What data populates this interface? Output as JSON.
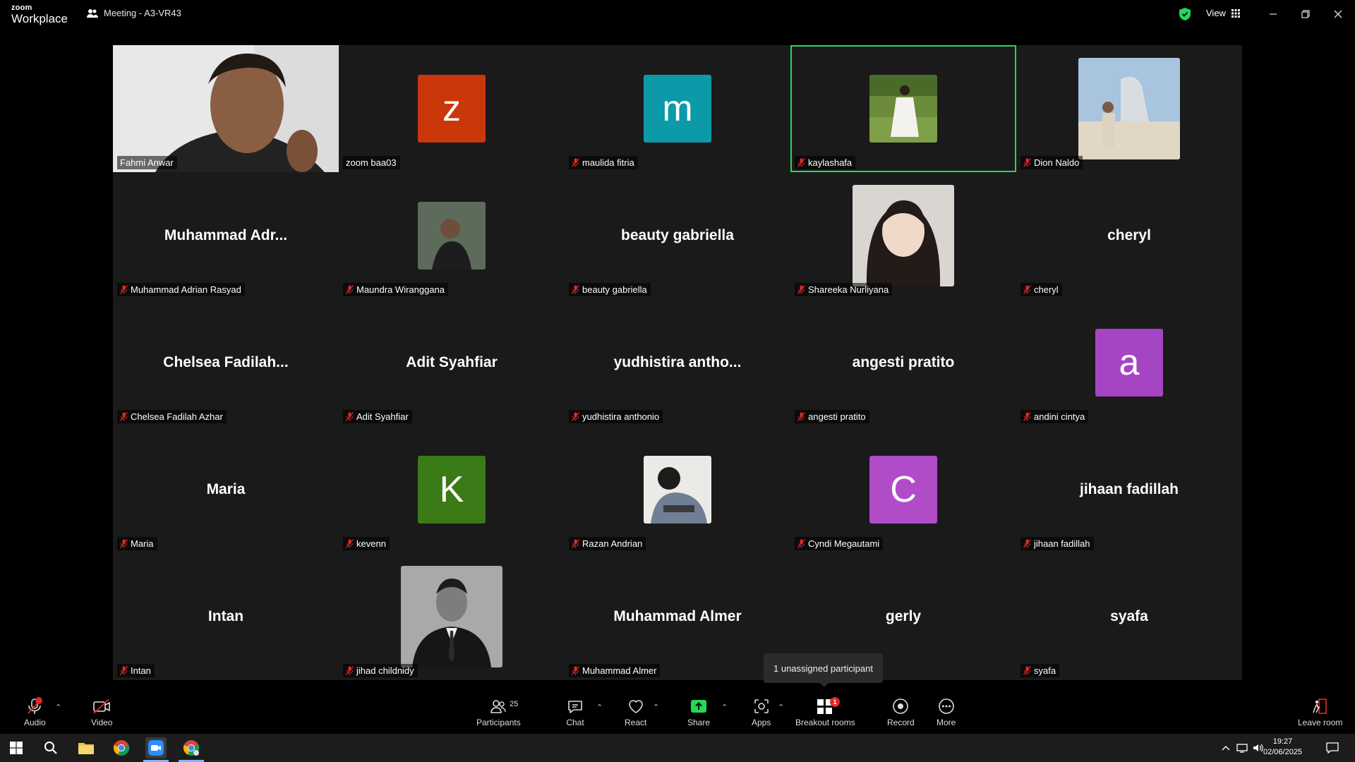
{
  "app": {
    "brand_top": "zoom",
    "brand_bottom": "Workplace",
    "meeting_title": "Meeting - A3-VR43",
    "view_label": "View"
  },
  "participants": [
    {
      "name": "Fahmi Anwar",
      "display": "",
      "type": "video",
      "muted": false
    },
    {
      "name": "zoom baa03",
      "display": "z",
      "type": "avatar",
      "color": "#c9370a",
      "muted": false
    },
    {
      "name": "maulida fitria",
      "display": "m",
      "type": "avatar",
      "color": "#0c9aa8",
      "muted": true
    },
    {
      "name": "kaylashafa",
      "display": "",
      "type": "photo",
      "muted": true,
      "active": true
    },
    {
      "name": "Dion Naldo",
      "display": "",
      "type": "photo",
      "muted": true
    },
    {
      "name": "Muhammad Adrian Rasyad",
      "display": "Muhammad  Adr...",
      "type": "text",
      "muted": true
    },
    {
      "name": "Maundra Wiranggana",
      "display": "",
      "type": "photo",
      "muted": true
    },
    {
      "name": "beauty gabriella",
      "display": "beauty gabriella",
      "type": "text",
      "muted": true
    },
    {
      "name": "Shareeka Nurliyana",
      "display": "",
      "type": "photo",
      "muted": true
    },
    {
      "name": "cheryl",
      "display": "cheryl",
      "type": "text",
      "muted": true
    },
    {
      "name": "Chelsea Fadilah Azhar",
      "display": "Chelsea  Fadilah...",
      "type": "text",
      "muted": true
    },
    {
      "name": "Adit Syahfiar",
      "display": "Adit Syahfiar",
      "type": "text",
      "muted": true
    },
    {
      "name": "yudhistira anthonio",
      "display": "yudhistira  antho...",
      "type": "text",
      "muted": true
    },
    {
      "name": "angesti pratito",
      "display": "angesti pratito",
      "type": "text",
      "muted": true
    },
    {
      "name": "andini cintya",
      "display": "a",
      "type": "avatar",
      "color": "#a545c4",
      "muted": true
    },
    {
      "name": "Maria",
      "display": "Maria",
      "type": "text",
      "muted": true
    },
    {
      "name": "kevenn",
      "display": "K",
      "type": "avatar",
      "color": "#3a7a17",
      "muted": true
    },
    {
      "name": "Razan Andrian",
      "display": "",
      "type": "photo",
      "muted": true
    },
    {
      "name": "Cyndi Megautami",
      "display": "C",
      "type": "avatar",
      "color": "#b14cc9",
      "muted": true
    },
    {
      "name": "jihaan fadillah",
      "display": "jihaan fadillah",
      "type": "text",
      "muted": true
    },
    {
      "name": "Intan",
      "display": "Intan",
      "type": "text",
      "muted": true
    },
    {
      "name": "jihad childnidy",
      "display": "",
      "type": "photo",
      "muted": true
    },
    {
      "name": "Muhammad Almer",
      "display": "Muhammad Almer",
      "type": "text",
      "muted": true
    },
    {
      "name": "gerly",
      "display": "gerly",
      "type": "text",
      "muted": true
    },
    {
      "name": "syafa",
      "display": "syafa",
      "type": "text",
      "muted": true
    }
  ],
  "tooltip": "1 unassigned participant",
  "toolbar": {
    "audio": "Audio",
    "video": "Video",
    "participants": "Participants",
    "participants_count": "25",
    "chat": "Chat",
    "react": "React",
    "share": "Share",
    "apps": "Apps",
    "breakout": "Breakout rooms",
    "breakout_badge": "1",
    "record": "Record",
    "more": "More",
    "leave": "Leave room"
  },
  "taskbar": {
    "time": "19:27",
    "date": "02/06/2025"
  },
  "colors": {
    "active_border": "#23d959",
    "share_green": "#23d959",
    "muted_red": "#e02828"
  }
}
